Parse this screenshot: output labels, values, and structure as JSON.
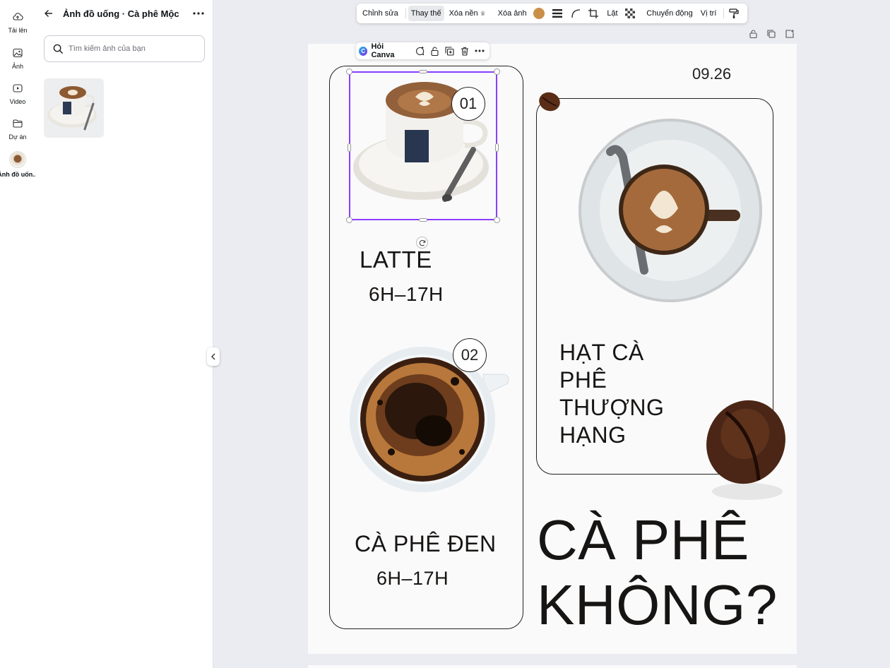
{
  "rail": {
    "items": [
      {
        "label": "Tải lên",
        "icon": "cloud-upload-icon"
      },
      {
        "label": "Ảnh",
        "icon": "image-icon"
      },
      {
        "label": "Video",
        "icon": "video-icon"
      },
      {
        "label": "Dự án",
        "icon": "folder-icon"
      },
      {
        "label": "Ảnh đồ uốn...",
        "icon": "coffee-thumbnail"
      }
    ]
  },
  "panel": {
    "title": "Ảnh đồ uống · Cà phê Mộc",
    "search_placeholder": "Tìm kiếm ảnh của bạn"
  },
  "toolbar": {
    "edit": "Chỉnh sửa",
    "replace": "Thay thế",
    "remove_bg": "Xóa nền",
    "delete_image": "Xóa ảnh",
    "flip": "Lật",
    "animate": "Chuyển động",
    "position": "Vị trí",
    "swatch_color": "#c98f48"
  },
  "floatbar": {
    "ask_label": "Hỏi Canva"
  },
  "design": {
    "date": "09.26",
    "badge1": "01",
    "badge2": "02",
    "item1_name": "LATTE",
    "item1_hours": "6H–17H",
    "item2_name": "CÀ PHÊ ĐEN",
    "item2_hours": "6H–17H",
    "beans_line1": "HẠT CÀ",
    "beans_line2": "PHÊ",
    "beans_line3": "THƯỢNG",
    "beans_line4": "HẠNG",
    "headline_line1": "CÀ PHÊ",
    "headline_line2": "KHÔNG?"
  }
}
